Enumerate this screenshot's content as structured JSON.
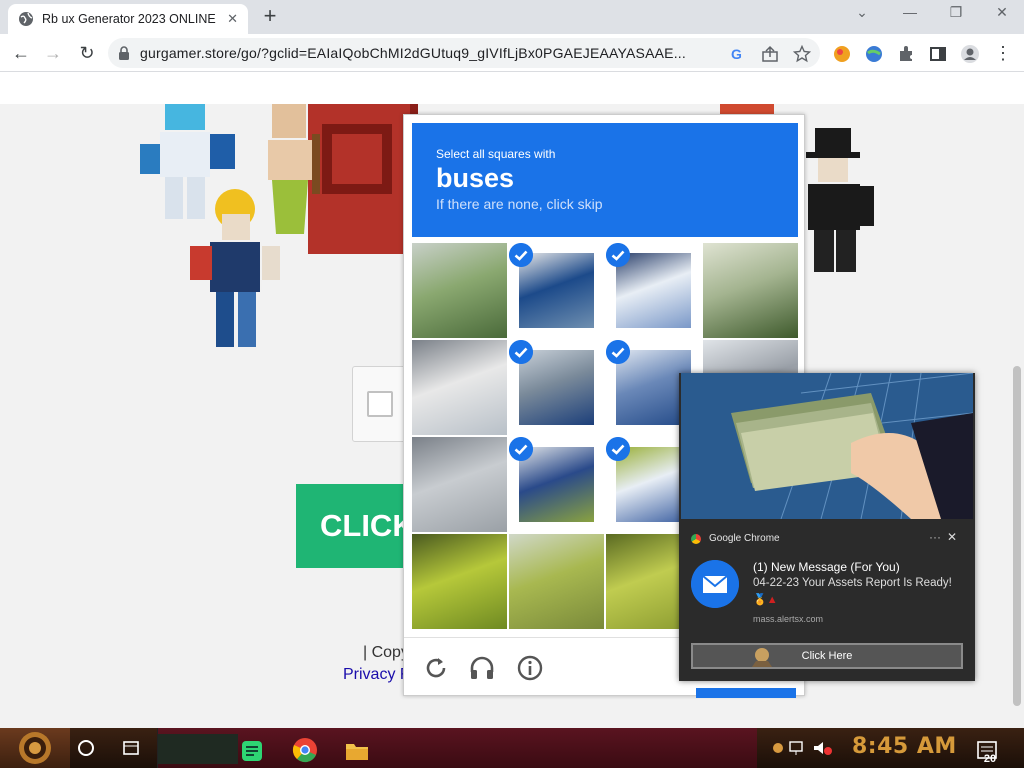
{
  "browser": {
    "tab_title": "Rb ux Generator 2023 ONLINE",
    "tab_close": "✕",
    "new_tab": "+",
    "url": "gurgamer.store/go/?gclid=EAIaIQobChMI2dGUtuq9_gIVIfLjBx0PGAEJEAAYASAAE..."
  },
  "page": {
    "cta_label": "CLICK",
    "copyright": "| Copy",
    "privacy": "Privacy F"
  },
  "captcha": {
    "instruction": "Select all squares with",
    "target": "buses",
    "hint": "If there are none, click skip",
    "selected": [
      false,
      true,
      true,
      false,
      false,
      true,
      true,
      false,
      false,
      true,
      true,
      false,
      false,
      false,
      false,
      false
    ]
  },
  "notification": {
    "app": "Google Chrome",
    "title": "(1) New Message (For You)",
    "body": "04-22-23 Your Assets Report Is Ready!",
    "source": "mass.alertsx.com",
    "button": "Click Here"
  },
  "taskbar": {
    "time": "8:45 AM",
    "notification_count": "20"
  },
  "colors": {
    "captcha_blue": "#1a73e8",
    "cta_green": "#1fb574",
    "clock": "#d69a3a"
  }
}
